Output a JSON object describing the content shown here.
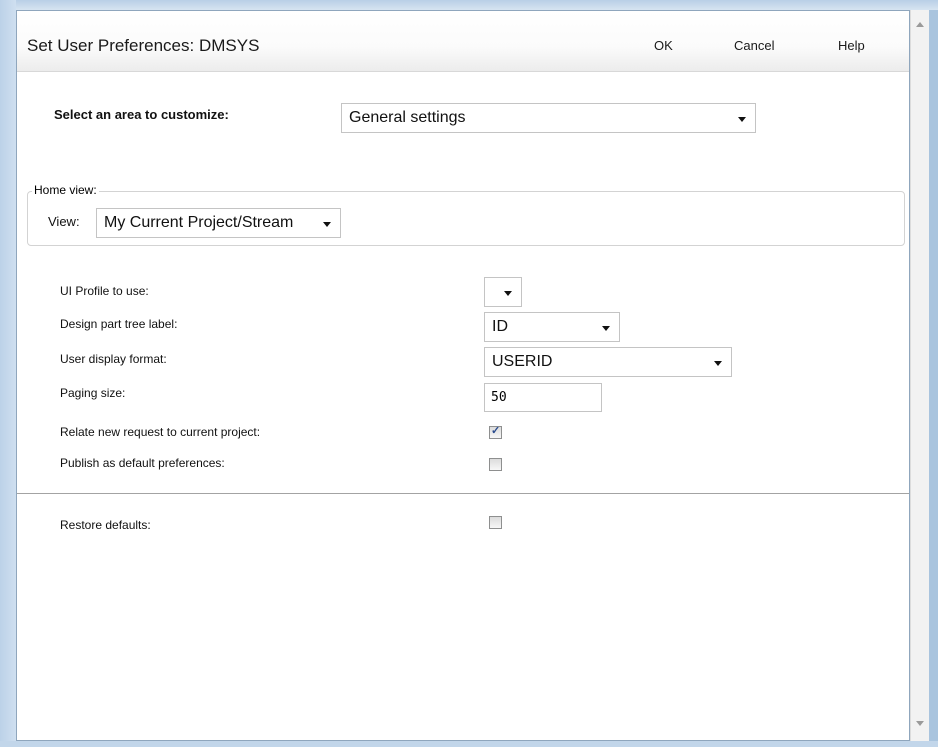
{
  "dialog": {
    "title": "Set User Preferences: DMSYS",
    "ok_label": "OK",
    "cancel_label": "Cancel",
    "help_label": "Help"
  },
  "area": {
    "label": "Select an area to customize:",
    "selected": "General settings"
  },
  "home_view": {
    "legend": "Home view:",
    "view_label": "View:",
    "view_selected": "My Current Project/Stream"
  },
  "fields": {
    "ui_profile_label": "UI Profile to use:",
    "ui_profile_selected": "",
    "design_part_label": "Design part tree label:",
    "design_part_selected": "ID",
    "user_display_label": "User display format:",
    "user_display_selected": "USERID",
    "paging_label": "Paging size:",
    "paging_value": "50",
    "relate_label": "Relate new request to current project:",
    "relate_checked": true,
    "publish_label": "Publish as default preferences:",
    "publish_checked": false,
    "restore_label": "Restore defaults:",
    "restore_checked": false
  },
  "colors": {
    "checkmark": "#2a4b8d",
    "frame": "#a9c4de"
  }
}
